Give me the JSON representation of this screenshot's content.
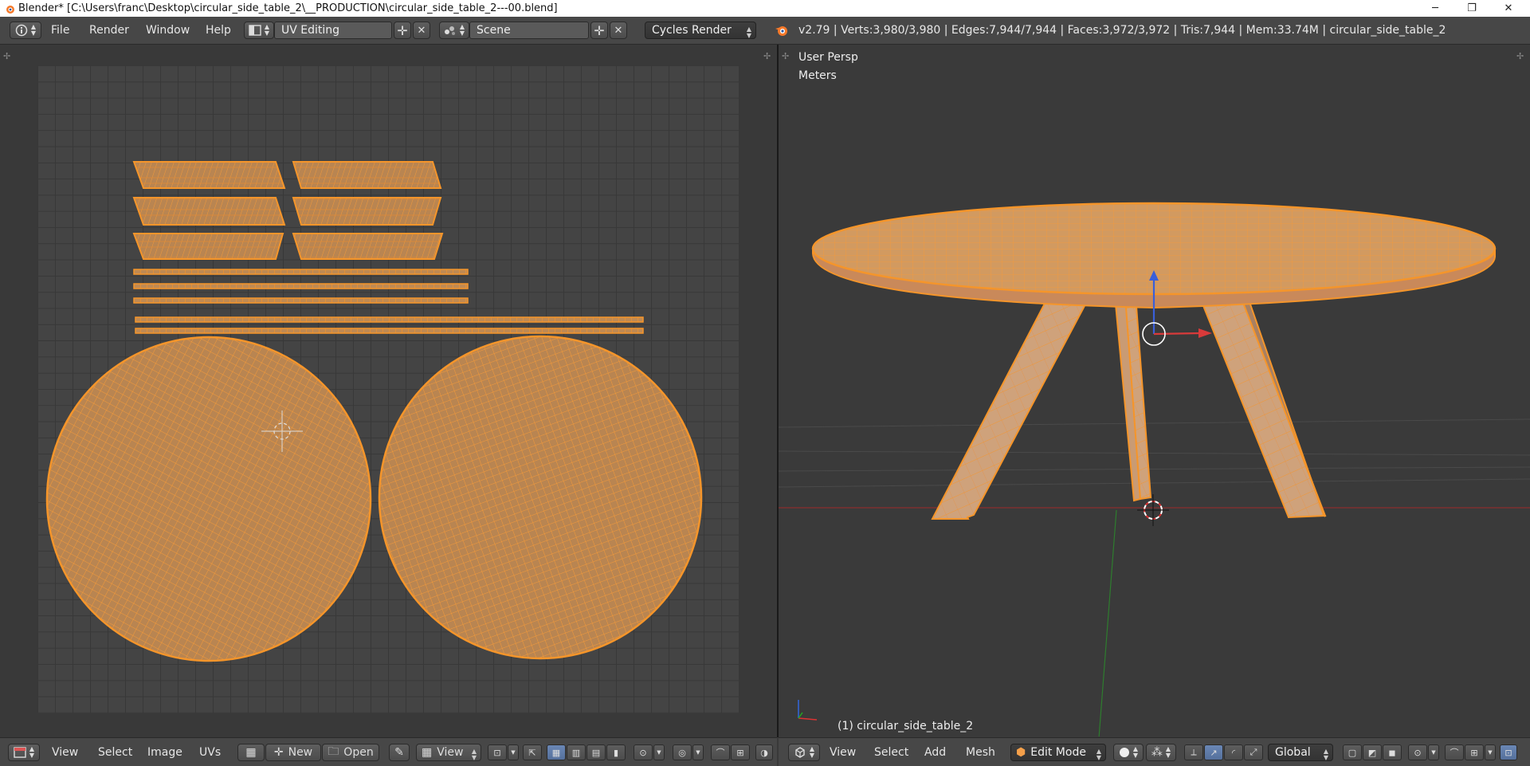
{
  "os_window": {
    "title": "Blender* [C:\\Users\\franc\\Desktop\\circular_side_table_2\\__PRODUCTION\\circular_side_table_2---00.blend]",
    "minimize_glyph": "─",
    "restore_glyph": "❐",
    "close_glyph": "✕"
  },
  "info_header": {
    "menus": [
      "File",
      "Render",
      "Window",
      "Help"
    ],
    "screen_layout": "UV Editing",
    "scene": "Scene",
    "render_engine": "Cycles Render",
    "stats": "v2.79 | Verts:3,980/3,980 | Edges:7,944/7,944 | Faces:3,972/3,972 | Tris:7,944 | Mem:33.74M | circular_side_table_2"
  },
  "viewport_3d": {
    "view_name": "User Persp",
    "units": "Meters",
    "object_label": "(1) circular_side_table_2"
  },
  "uv_editor_header": {
    "menus": [
      "View",
      "Select",
      "Image",
      "UVs"
    ],
    "new_label": "New",
    "open_label": "Open",
    "view_dropdown": "View"
  },
  "view3d_header": {
    "menus": [
      "View",
      "Select",
      "Add",
      "Mesh"
    ],
    "mode": "Edit Mode",
    "orientation": "Global"
  },
  "colors": {
    "accent_orange": "#f5952a",
    "mesh_fill": "#c08a52",
    "grid": "#444444",
    "background": "#393939",
    "header": "#474747",
    "selected_button": "#5f7ba8"
  },
  "icons": [
    "blender-logo-icon",
    "info-editor-icon",
    "screen-layout-icon",
    "scene-icon",
    "add-icon",
    "close-icon",
    "uv-editor-icon",
    "view3d-editor-icon",
    "shading-sphere-icon",
    "manipulator-icon",
    "snap-icon"
  ]
}
